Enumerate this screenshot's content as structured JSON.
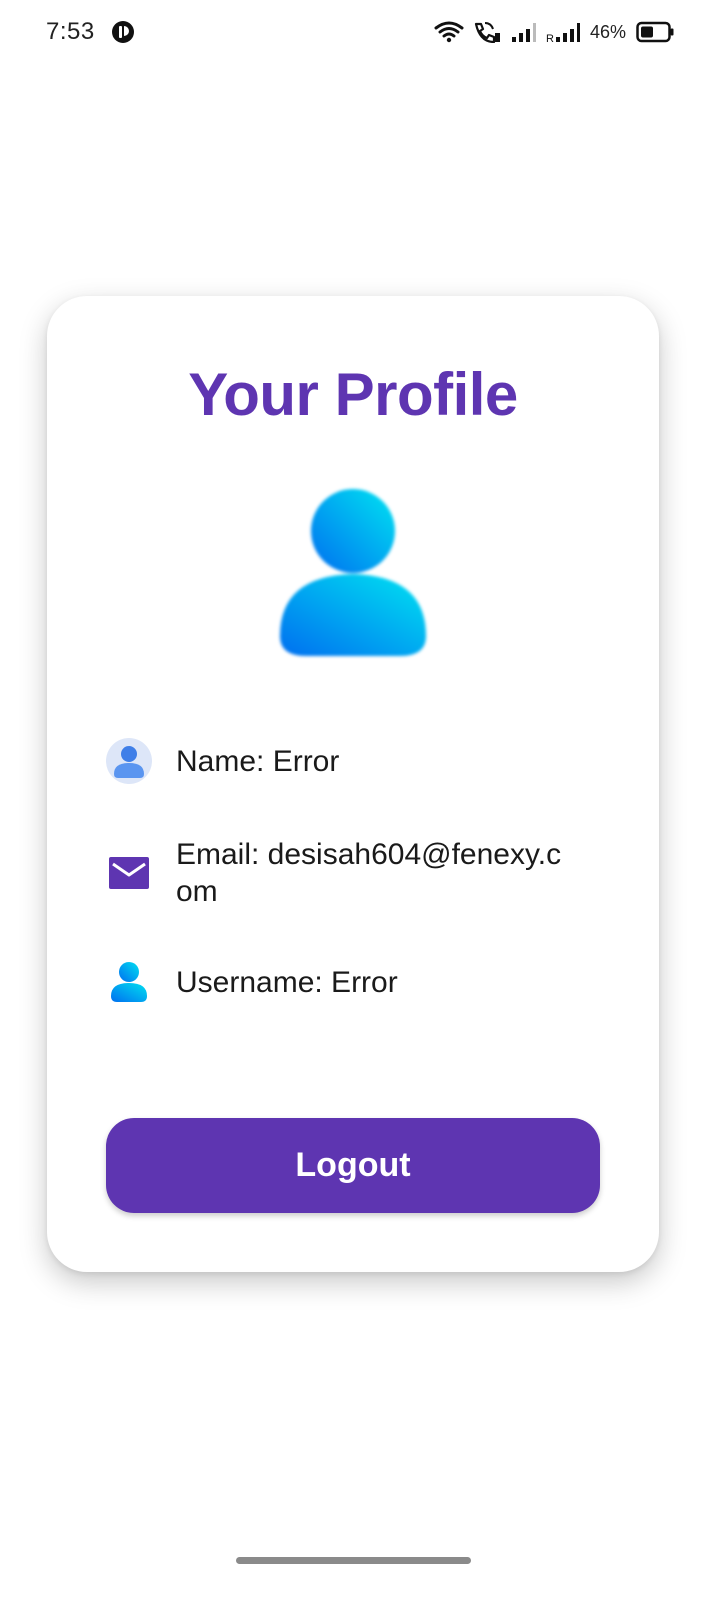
{
  "status_bar": {
    "time": "7:53",
    "battery_percent": "46%",
    "icons": [
      "app-notification-icon",
      "wifi-icon",
      "wifi-calling-icon",
      "signal-icon",
      "roaming-signal-icon",
      "battery-icon"
    ]
  },
  "profile": {
    "title": "Your Profile",
    "name_line": "Name: Error",
    "email_line": "Email: desisah604@fenexy.com",
    "username_line": "Username: Error",
    "logout_label": "Logout"
  },
  "colors": {
    "accent": "#5e35b1",
    "avatar_gradient_start": "#00e0f0",
    "avatar_gradient_end": "#0070f0"
  }
}
